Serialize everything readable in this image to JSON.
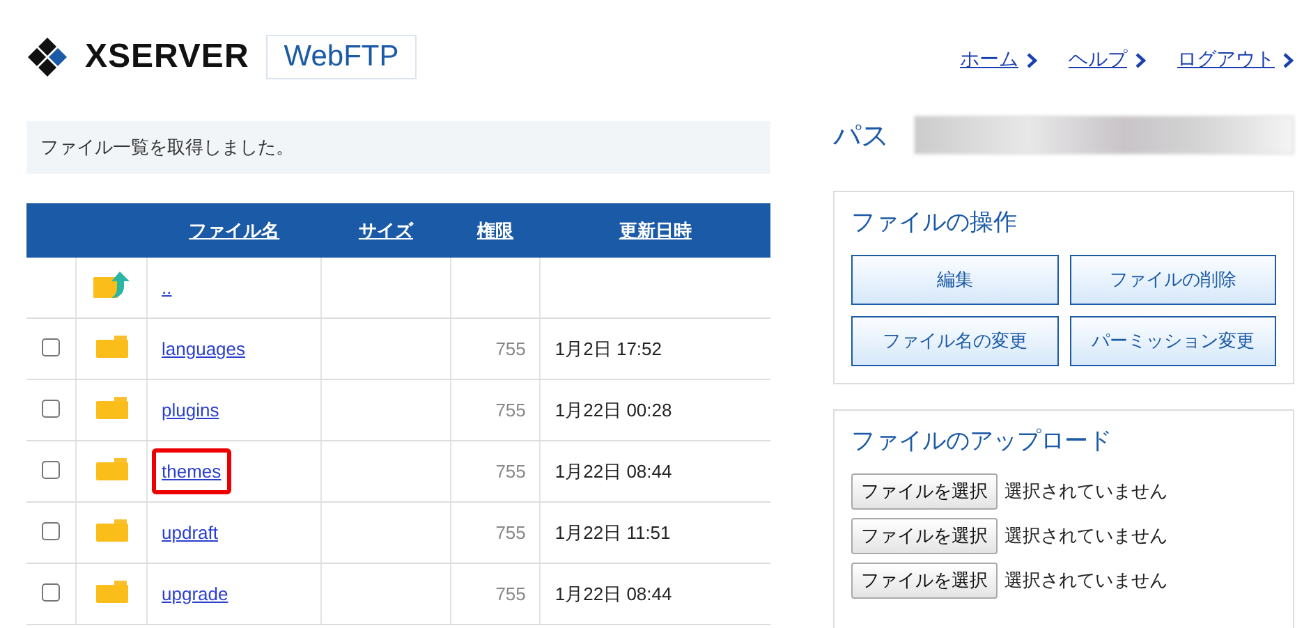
{
  "header": {
    "brand": "XSERVER",
    "app": "WebFTP",
    "links": [
      "ホーム",
      "ヘルプ",
      "ログアウト"
    ]
  },
  "message": "ファイル一覧を取得しました。",
  "path": {
    "label": "パス"
  },
  "table": {
    "columns": [
      "ファイル名",
      "サイズ",
      "権限",
      "更新日時"
    ],
    "rows": [
      {
        "kind": "parent",
        "name": "..",
        "highlighted": false
      },
      {
        "kind": "folder",
        "name": "languages",
        "perm": "755",
        "date": "1月2日 17:52",
        "checked": false,
        "highlighted": false
      },
      {
        "kind": "folder",
        "name": "plugins",
        "perm": "755",
        "date": "1月22日 00:28",
        "checked": false,
        "highlighted": false
      },
      {
        "kind": "folder",
        "name": "themes",
        "perm": "755",
        "date": "1月22日 08:44",
        "checked": false,
        "highlighted": true
      },
      {
        "kind": "folder",
        "name": "updraft",
        "perm": "755",
        "date": "1月22日 11:51",
        "checked": false,
        "highlighted": false
      },
      {
        "kind": "folder",
        "name": "upgrade",
        "perm": "755",
        "date": "1月22日 08:44",
        "checked": false,
        "highlighted": false
      }
    ]
  },
  "operations": {
    "title": "ファイルの操作",
    "buttons": [
      "編集",
      "ファイルの削除",
      "ファイル名の変更",
      "パーミッション変更"
    ]
  },
  "upload": {
    "title": "ファイルのアップロード",
    "rows": [
      {
        "button": "ファイルを選択",
        "status": "選択されていません"
      },
      {
        "button": "ファイルを選択",
        "status": "選択されていません"
      },
      {
        "button": "ファイルを選択",
        "status": "選択されていません"
      }
    ]
  }
}
